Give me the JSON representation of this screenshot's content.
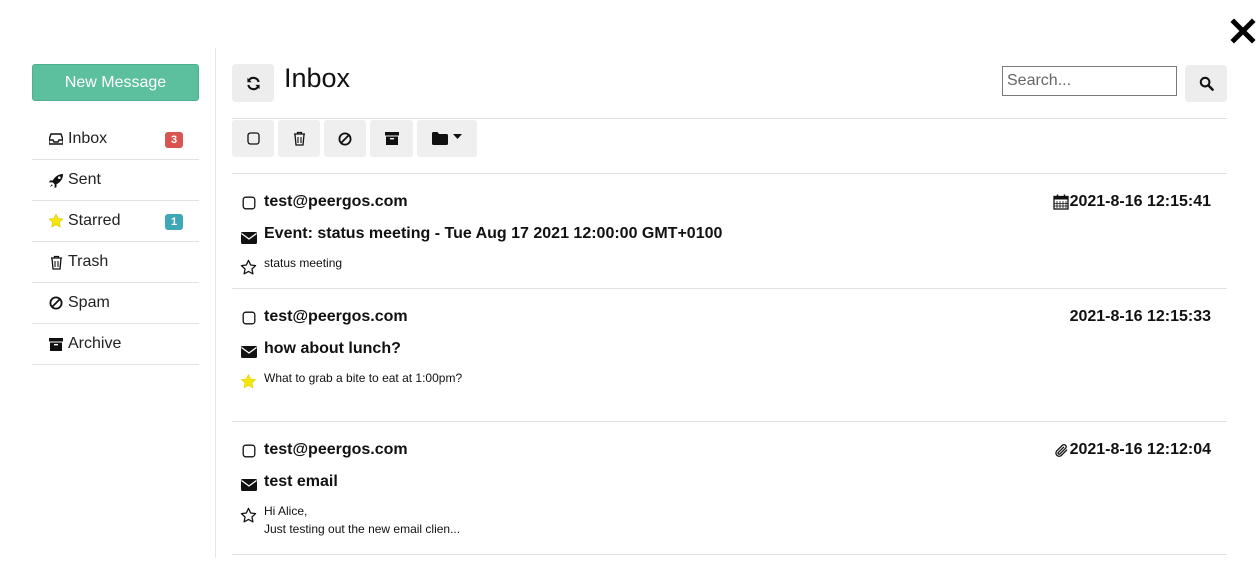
{
  "sidebar": {
    "new_message_label": "New Message",
    "folders": [
      {
        "label": "Inbox",
        "icon": "inbox-icon",
        "badge": "3",
        "badge_color": "#d9534f"
      },
      {
        "label": "Sent",
        "icon": "rocket-icon"
      },
      {
        "label": "Starred",
        "icon": "star-icon",
        "badge": "1",
        "badge_color": "#3fa7b6"
      },
      {
        "label": "Trash",
        "icon": "trash-icon"
      },
      {
        "label": "Spam",
        "icon": "ban-icon"
      },
      {
        "label": "Archive",
        "icon": "archive-icon"
      }
    ]
  },
  "header": {
    "title": "Inbox",
    "search_placeholder": "Search..."
  },
  "toolbar": {
    "buttons": [
      "select-all",
      "delete",
      "mark-spam",
      "archive",
      "move-to-folder"
    ]
  },
  "messages": [
    {
      "from": "test@peergos.com",
      "date": "2021-8-16 12:15:41",
      "date_icon": "calendar-icon",
      "subject": "Event: status meeting - Tue Aug 17 2021 12:00:00 GMT+0100",
      "preview": "status meeting",
      "starred": false
    },
    {
      "from": "test@peergos.com",
      "date": "2021-8-16 12:15:33",
      "subject": "how about lunch?",
      "preview": "What to grab a bite to eat at 1:00pm?",
      "starred": true
    },
    {
      "from": "test@peergos.com",
      "date": "2021-8-16 12:12:04",
      "date_icon": "paperclip-icon",
      "subject": "test email",
      "preview": "Hi Alice,\nJust testing out the new email clien...",
      "starred": false
    }
  ],
  "colors": {
    "accent": "#5cbf9d",
    "inbox_badge": "#d9534f",
    "starred_badge": "#3fa7b6",
    "star_filled": "#f5e50a"
  }
}
